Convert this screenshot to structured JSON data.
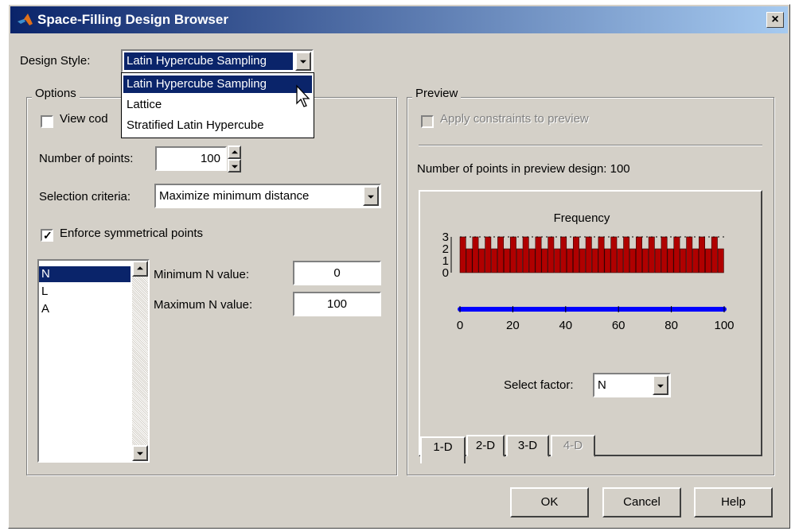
{
  "window": {
    "title": "Space-Filling Design Browser",
    "close_glyph": "×"
  },
  "design_style": {
    "label": "Design Style:",
    "value": "Latin Hypercube Sampling",
    "options": [
      "Latin Hypercube Sampling",
      "Lattice",
      "Stratified Latin Hypercube"
    ]
  },
  "options": {
    "legend": "Options",
    "view_code_label": "View cod",
    "num_points_label": "Number of points:",
    "num_points_value": "100",
    "selection_label": "Selection criteria:",
    "selection_value": "Maximize minimum distance",
    "enforce_label": "Enforce symmetrical points",
    "enforce_checked": true,
    "factors": [
      "N",
      "L",
      "A"
    ],
    "min_label": "Minimum N value:",
    "min_value": "0",
    "max_label": "Maximum N value:",
    "max_value": "100"
  },
  "preview": {
    "legend": "Preview",
    "apply_label": "Apply constraints to preview",
    "info": "Number of points in preview design: 100",
    "select_factor_label": "Select factor:",
    "select_factor_value": "N",
    "tabs": [
      "1-D",
      "2-D",
      "3-D",
      "4-D"
    ]
  },
  "chart_data": {
    "type": "bar",
    "title": "Frequency",
    "yticks": [
      "3",
      "2",
      "1",
      "0"
    ],
    "ylim": [
      0,
      3
    ],
    "xlim": [
      0,
      100
    ],
    "xticks": [
      "0",
      "20",
      "40",
      "60",
      "80",
      "100"
    ],
    "bar_values": [
      3,
      2,
      3,
      2,
      3,
      2,
      3,
      2,
      3,
      2,
      3,
      2,
      3,
      2,
      3,
      2,
      3,
      2,
      3,
      2,
      3,
      2,
      3,
      2,
      3,
      2,
      3,
      2,
      3,
      2,
      3,
      2,
      3,
      2,
      3,
      2,
      3,
      2,
      3,
      2,
      3,
      2
    ],
    "colors": {
      "bar": "#b00000",
      "bar_top": "#e00000",
      "points": "#0000ff"
    }
  },
  "buttons": {
    "ok": "OK",
    "cancel": "Cancel",
    "help": "Help"
  },
  "colors": {
    "title_start": "#0a246a",
    "title_end": "#a6caf0",
    "face": "#d4d0c8",
    "selection": "#0a246a"
  }
}
